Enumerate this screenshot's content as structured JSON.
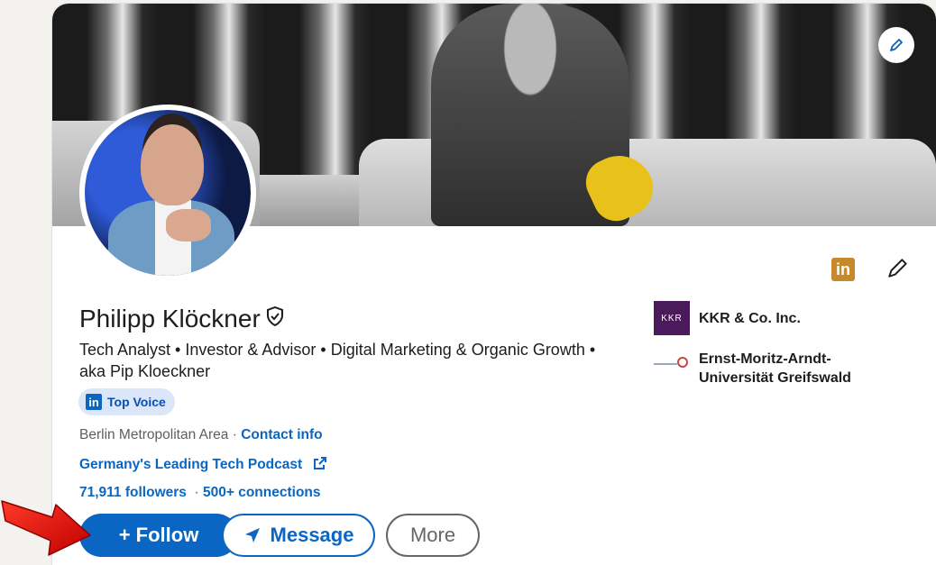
{
  "profile": {
    "name": "Philipp Klöckner",
    "headline": "Tech Analyst • Investor & Advisor • Digital Marketing & Organic Growth • aka Pip Kloeckner",
    "badge": "Top Voice",
    "location": "Berlin Metropolitan Area",
    "location_separator": " · ",
    "contact_link": "Contact info",
    "website": "Germany's Leading Tech Podcast",
    "followers": "71,911 followers",
    "connections_separator": "  · ",
    "connections": "500+ connections"
  },
  "organizations": [
    {
      "logo_text": "KKR",
      "name": "KKR & Co. Inc."
    },
    {
      "name_line1": "Ernst-Moritz-Arndt-",
      "name_line2": "Universität Greifswald"
    }
  ],
  "actions": {
    "follow": "+ Follow",
    "message": "Message",
    "more": "More"
  },
  "icons": {
    "banner_edit": "pencil-icon",
    "linkedin": "linkedin-icon",
    "edit": "pencil-icon",
    "verified": "shield-check-icon",
    "external_link": "external-link-icon",
    "send": "paper-plane-icon",
    "annotation": "red-arrow"
  },
  "colors": {
    "brand": "#0a66c2",
    "topvoice_bg": "#dbe7f9",
    "linkedin_accent": "#c68a2a",
    "kkr_bg": "#4a1a5a",
    "arrow": "#e01010"
  }
}
